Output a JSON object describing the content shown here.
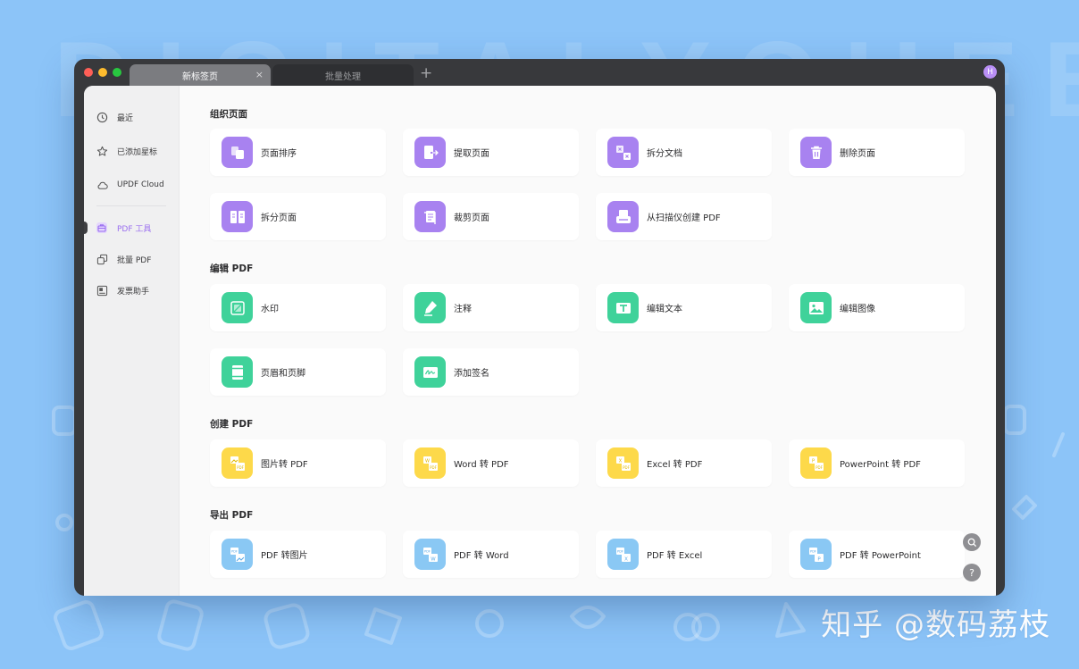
{
  "background": {
    "deco_text": "DIGITALYOUEE",
    "watermark": "知乎 @数码荔枝"
  },
  "tabs": [
    {
      "label": "新标签页",
      "active": true
    },
    {
      "label": "批量处理",
      "active": false
    }
  ],
  "titlebar": {
    "close_glyph": "×",
    "add_glyph": "+",
    "avatar_initial": "H"
  },
  "sidebar": {
    "items": [
      {
        "label": "最近",
        "icon": "clock-icon"
      },
      {
        "label": "已添加星标",
        "icon": "star-icon"
      },
      {
        "label": "UPDF Cloud",
        "icon": "cloud-icon"
      },
      {
        "label": "PDF 工具",
        "icon": "toolbox-icon",
        "active": true
      },
      {
        "label": "批量 PDF",
        "icon": "batch-icon"
      },
      {
        "label": "发票助手",
        "icon": "invoice-icon"
      }
    ]
  },
  "sections": [
    {
      "title": "组织页面",
      "color": "#a882f0",
      "cards": [
        {
          "label": "页面排序",
          "icon": "reorder-pages-icon"
        },
        {
          "label": "提取页面",
          "icon": "extract-pages-icon"
        },
        {
          "label": "拆分文档",
          "icon": "split-document-icon"
        },
        {
          "label": "删除页面",
          "icon": "trash-icon"
        },
        {
          "label": "拆分页面",
          "icon": "split-pages-icon"
        },
        {
          "label": "裁剪页面",
          "icon": "crop-pages-icon"
        },
        {
          "label": "从扫描仪创建 PDF",
          "icon": "scanner-icon"
        }
      ]
    },
    {
      "title": "编辑 PDF",
      "color": "#3fd29a",
      "cards": [
        {
          "label": "水印",
          "icon": "watermark-icon"
        },
        {
          "label": "注释",
          "icon": "annotate-icon"
        },
        {
          "label": "编辑文本",
          "icon": "edit-text-icon"
        },
        {
          "label": "编辑图像",
          "icon": "edit-image-icon"
        },
        {
          "label": "页眉和页脚",
          "icon": "header-footer-icon"
        },
        {
          "label": "添加签名",
          "icon": "signature-icon"
        }
      ]
    },
    {
      "title": "创建 PDF",
      "color": "#fdd94a",
      "cards": [
        {
          "label": "图片转 PDF",
          "icon": "image-to-pdf-icon"
        },
        {
          "label": "Word 转 PDF",
          "icon": "word-to-pdf-icon"
        },
        {
          "label": "Excel 转 PDF",
          "icon": "excel-to-pdf-icon"
        },
        {
          "label": "PowerPoint 转 PDF",
          "icon": "powerpoint-to-pdf-icon"
        }
      ]
    },
    {
      "title": "导出 PDF",
      "color": "#8ac8f4",
      "cards": [
        {
          "label": "PDF 转图片",
          "icon": "pdf-to-image-icon"
        },
        {
          "label": "PDF 转 Word",
          "icon": "pdf-to-word-icon"
        },
        {
          "label": "PDF 转 Excel",
          "icon": "pdf-to-excel-icon"
        },
        {
          "label": "PDF 转 PowerPoint",
          "icon": "pdf-to-powerpoint-icon"
        }
      ]
    }
  ],
  "floating": {
    "search_icon": "search-icon",
    "help_glyph": "?"
  }
}
